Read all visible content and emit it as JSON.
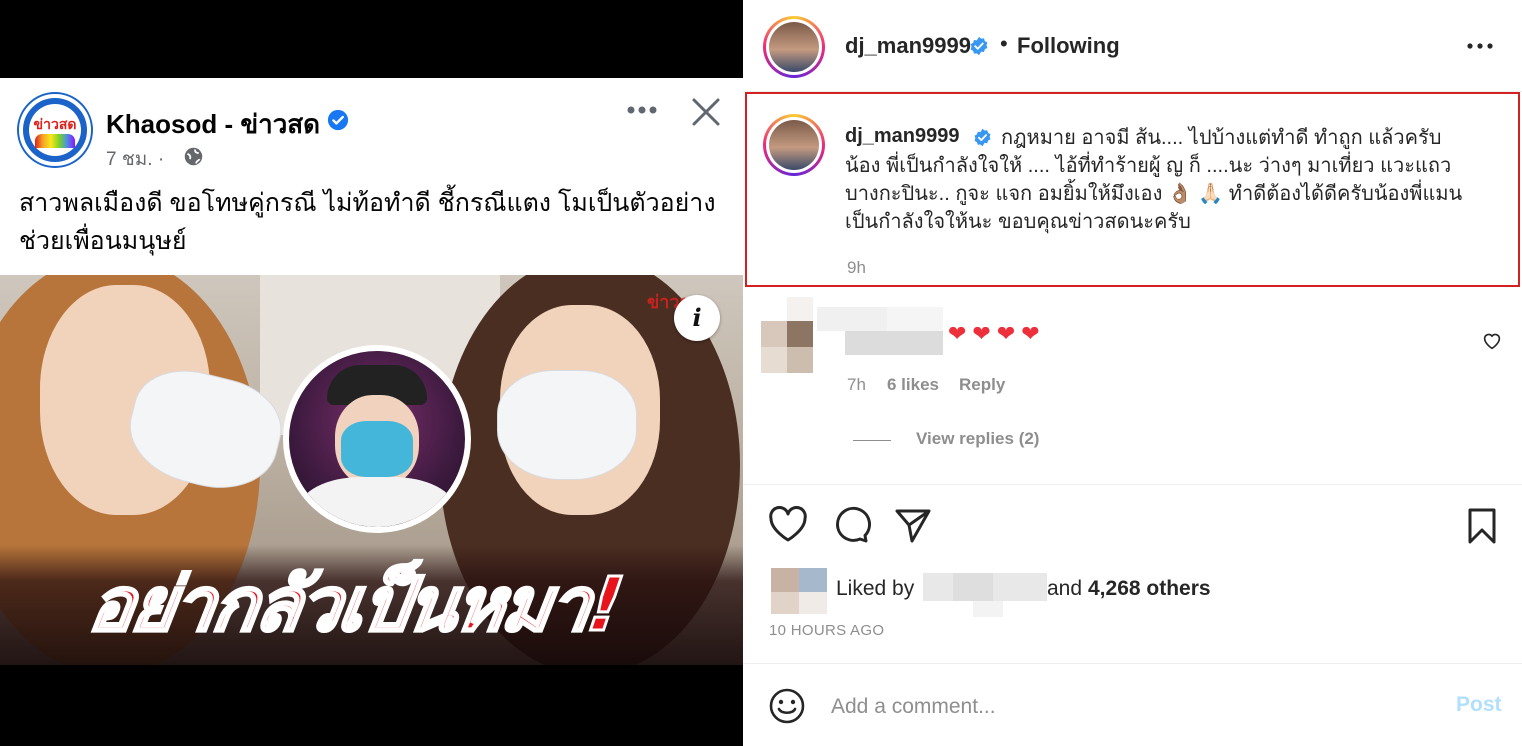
{
  "facebook_post": {
    "page_name": "Khaosod - ข่าวสด",
    "logo_text": "ข่าวสด",
    "meta": "7 ชม. ·",
    "headline": "สาวพลเมืองดี ขอโทษคู่กรณี ไม่ท้อทำดี ชี้กรณีแตง โมเป็นตัวอย่างช่วยเพื่อนมนุษย์",
    "image_banner_text": "อย่ากลัวเป็นหมา!",
    "image_watermark": "ข่าวสด",
    "info_icon_glyph": "i"
  },
  "instagram": {
    "header": {
      "username": "dj_man9999",
      "separator": "•",
      "following_label": "Following"
    },
    "caption": {
      "username": "dj_man9999",
      "text": "กฎหมาย อาจมี ส้น.... ไปบ้างแต่ทำดี ทำถูก แล้วครับน้อง พี่เป็นกำลังใจให้ .... ไอ้ที่ทำร้ายผู้ ญ ก็ ....นะ ว่างๆ มาเที่ยว แวะแถวบางกะปินะ.. กูจะ แจก อมยิ้มให้มึงเอง 👌🏽 🙏🏻 ทำดีต้องได้ดีครับน้องพี่แมนเป็นกำลังใจให้นะ ขอบคุณข่าวสดนะครับ",
      "time": "9h"
    },
    "comment": {
      "hearts": "❤❤❤❤",
      "time": "7h",
      "likes": "6 likes",
      "reply_label": "Reply",
      "view_replies": "View replies (2)"
    },
    "likes": {
      "liked_by_prefix": "Liked by",
      "and_label": "and",
      "others": "4,268 others"
    },
    "post_date": "10 HOURS AGO",
    "comment_box": {
      "placeholder": "Add a comment...",
      "post_label": "Post"
    },
    "colors": {
      "verified_blue": "#3897f0",
      "heart_red": "#ed2f3b",
      "highlight_box": "#d32020",
      "post_button": "#b2dffc"
    }
  }
}
